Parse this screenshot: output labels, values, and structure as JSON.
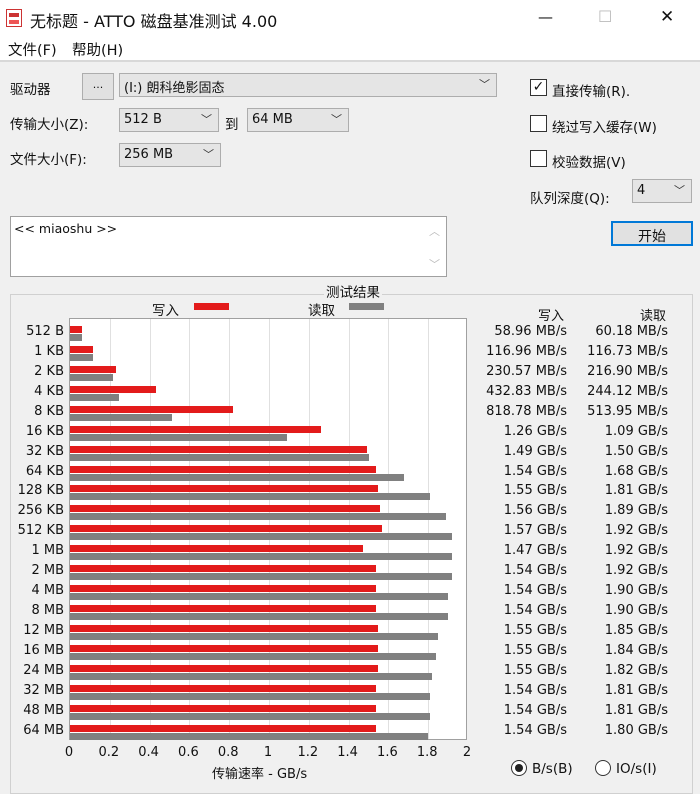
{
  "window": {
    "title": "无标题 - ATTO 磁盘基准测试 4.00",
    "minimize": "—",
    "maximize": "☐",
    "close": "✕"
  },
  "menu": [
    {
      "label": "文件(F)"
    },
    {
      "label": "帮助(H)"
    }
  ],
  "form": {
    "drive_label": "驱动器",
    "browse_label": "...",
    "drive_value": "(I:) 朗科绝影固态",
    "transfer_label": "传输大小(Z):",
    "transfer_from": "512 B",
    "to_label": "到",
    "transfer_to": "64 MB",
    "file_label": "文件大小(F):",
    "file_value": "256 MB",
    "direct_io": {
      "label": "直接传输(R).",
      "checked": true
    },
    "bypass_cache": {
      "label": "绕过写入缓存(W)",
      "checked": false
    },
    "verify": {
      "label": "校验数据(V)",
      "checked": false
    },
    "queue_label": "队列深度(Q):",
    "queue_value": "4",
    "start_label": "开始",
    "description": "<< miaoshu >>"
  },
  "results": {
    "title": "测试结果",
    "write_legend": "写入",
    "read_legend": "读取",
    "write_header": "写入",
    "read_header": "读取",
    "colors": {
      "write": "#e31b1b",
      "read": "#808080"
    },
    "unit_bytes": "B/s(B)",
    "unit_io": "IO/s(I)",
    "unit_selected": "B/s"
  },
  "chart_data": {
    "type": "bar",
    "orientation": "horizontal",
    "xlabel": "传输速率 - GB/s",
    "xlim": [
      0,
      2
    ],
    "xticks": [
      "0",
      "0.2",
      "0.4",
      "0.6",
      "0.8",
      "1",
      "1.2",
      "1.4",
      "1.6",
      "1.8",
      "2"
    ],
    "categories": [
      "512 B",
      "1 KB",
      "2 KB",
      "4 KB",
      "8 KB",
      "16 KB",
      "32 KB",
      "64 KB",
      "128 KB",
      "256 KB",
      "512 KB",
      "1 MB",
      "2 MB",
      "4 MB",
      "8 MB",
      "12 MB",
      "16 MB",
      "24 MB",
      "32 MB",
      "48 MB",
      "64 MB"
    ],
    "series": [
      {
        "name": "写入",
        "values": [
          0.059,
          0.117,
          0.231,
          0.433,
          0.819,
          1.26,
          1.49,
          1.54,
          1.55,
          1.56,
          1.57,
          1.47,
          1.54,
          1.54,
          1.54,
          1.55,
          1.55,
          1.55,
          1.54,
          1.54,
          1.54
        ],
        "labels": [
          "58.96 MB/s",
          "116.96 MB/s",
          "230.57 MB/s",
          "432.83 MB/s",
          "818.78 MB/s",
          "1.26 GB/s",
          "1.49 GB/s",
          "1.54 GB/s",
          "1.55 GB/s",
          "1.56 GB/s",
          "1.57 GB/s",
          "1.47 GB/s",
          "1.54 GB/s",
          "1.54 GB/s",
          "1.54 GB/s",
          "1.55 GB/s",
          "1.55 GB/s",
          "1.55 GB/s",
          "1.54 GB/s",
          "1.54 GB/s",
          "1.54 GB/s"
        ]
      },
      {
        "name": "读取",
        "values": [
          0.06,
          0.117,
          0.217,
          0.244,
          0.514,
          1.09,
          1.5,
          1.68,
          1.81,
          1.89,
          1.92,
          1.92,
          1.92,
          1.9,
          1.9,
          1.85,
          1.84,
          1.82,
          1.81,
          1.81,
          1.8
        ],
        "labels": [
          "60.18 MB/s",
          "116.73 MB/s",
          "216.90 MB/s",
          "244.12 MB/s",
          "513.95 MB/s",
          "1.09 GB/s",
          "1.50 GB/s",
          "1.68 GB/s",
          "1.81 GB/s",
          "1.89 GB/s",
          "1.92 GB/s",
          "1.92 GB/s",
          "1.92 GB/s",
          "1.90 GB/s",
          "1.90 GB/s",
          "1.85 GB/s",
          "1.84 GB/s",
          "1.82 GB/s",
          "1.81 GB/s",
          "1.81 GB/s",
          "1.80 GB/s"
        ]
      }
    ]
  }
}
